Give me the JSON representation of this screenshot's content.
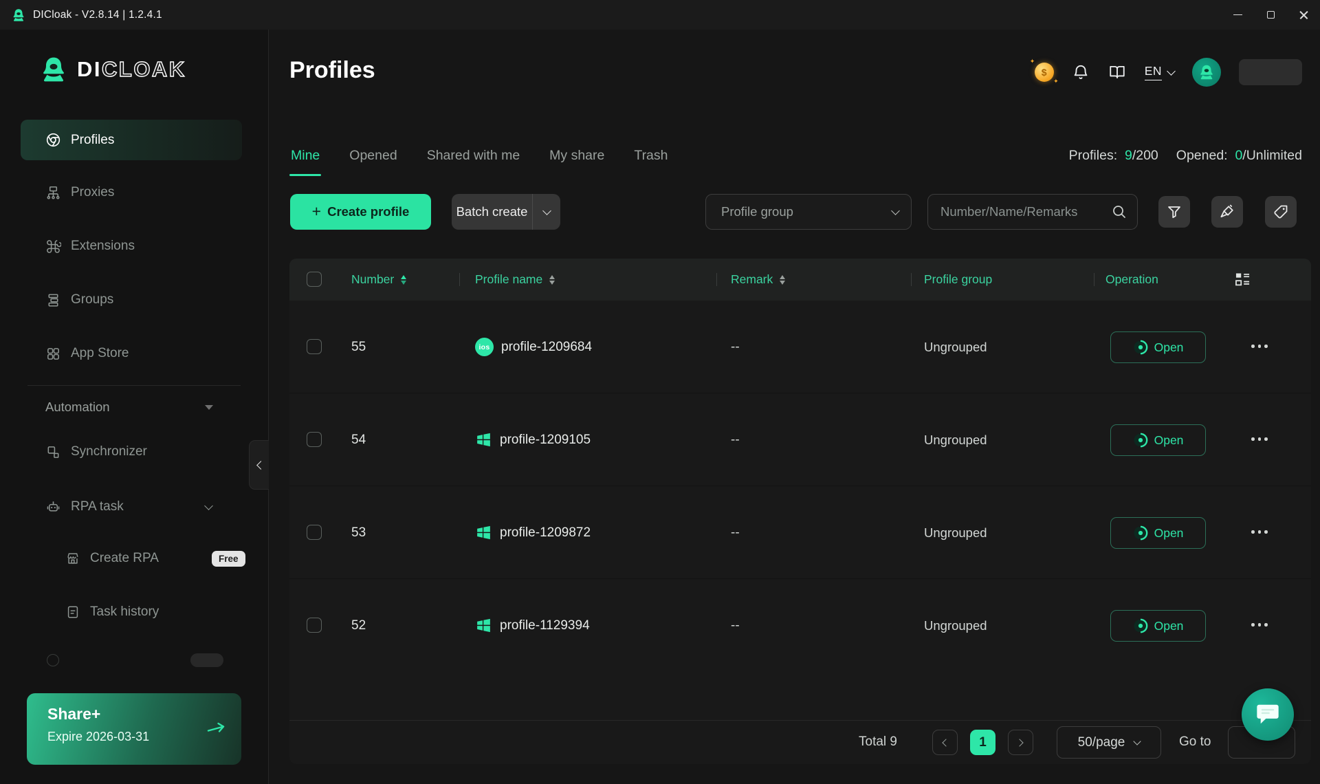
{
  "colors": {
    "accent": "#2ee6a8",
    "accent_text_on_green": "#0c261c",
    "table_header_green": "#3bd3a0",
    "share_gradient_start": "#2fbd8d"
  },
  "titlebar": {
    "title": "DICloak - V2.8.14 | 1.2.4.1"
  },
  "sidebar": {
    "logo": {
      "di": "DI",
      "cloak": "CLOAK"
    },
    "items": [
      {
        "label": "Profiles"
      },
      {
        "label": "Proxies"
      },
      {
        "label": "Extensions"
      },
      {
        "label": "Groups"
      },
      {
        "label": "App Store"
      }
    ],
    "section_label": "Automation",
    "automation_items": [
      {
        "label": "Synchronizer"
      },
      {
        "label": "RPA task"
      }
    ],
    "rpa_children": [
      {
        "label": "Create RPA",
        "badge": "Free"
      },
      {
        "label": "Task history"
      }
    ],
    "share": {
      "title": "Share+",
      "subtitle": "Expire 2026-03-31"
    }
  },
  "header": {
    "title": "Profiles",
    "lang": "EN"
  },
  "tabs": [
    {
      "label": "Mine"
    },
    {
      "label": "Opened"
    },
    {
      "label": "Shared with me"
    },
    {
      "label": "My share"
    },
    {
      "label": "Trash"
    }
  ],
  "stats": {
    "profiles_label": "Profiles:",
    "profiles_used": "9",
    "profiles_total": "/200",
    "opened_label": "Opened:",
    "opened_used": "0",
    "opened_total": "/Unlimited"
  },
  "toolbar": {
    "plus": "+",
    "create_label": "Create profile",
    "batch_label": "Batch create",
    "group_placeholder": "Profile group",
    "search_placeholder": "Number/Name/Remarks"
  },
  "table": {
    "headers": [
      {
        "label": "Number"
      },
      {
        "label": "Profile name"
      },
      {
        "label": "Remark"
      },
      {
        "label": "Profile group"
      },
      {
        "label": "Operation"
      }
    ],
    "open_label": "Open",
    "rows": [
      {
        "number": "55",
        "os": "ios",
        "name": "profile-1209684",
        "remark": "--",
        "group": "Ungrouped"
      },
      {
        "number": "54",
        "os": "windows",
        "name": "profile-1209105",
        "remark": "--",
        "group": "Ungrouped"
      },
      {
        "number": "53",
        "os": "windows",
        "name": "profile-1209872",
        "remark": "--",
        "group": "Ungrouped"
      },
      {
        "number": "52",
        "os": "windows",
        "name": "profile-1129394",
        "remark": "--",
        "group": "Ungrouped"
      }
    ]
  },
  "pagination": {
    "total": "Total 9",
    "current_page": "1",
    "per_page": "50/page",
    "goto_label": "Go to"
  }
}
